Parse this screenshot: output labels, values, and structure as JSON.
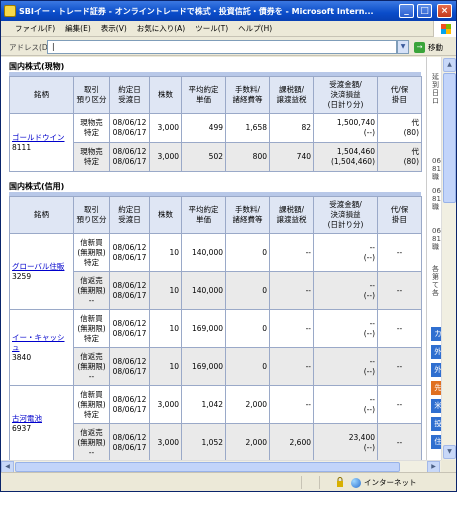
{
  "window": {
    "title": "SBIイー・トレード証券 - オンライントレードで株式・投資信託・債券を - Microsoft Intern...",
    "min_label": "_",
    "max_label": "□",
    "close_label": "×"
  },
  "menu": [
    "ファイル(F)",
    "編集(E)",
    "表示(V)",
    "お気に入り(A)",
    "ツール(T)",
    "ヘルプ(H)"
  ],
  "address": {
    "label": "アドレス(D)",
    "value": "|",
    "dropdown": "▼",
    "go_label": "移動",
    "go_icon": "→"
  },
  "colors": {
    "title_blue": "#0a4cc9",
    "link": "#0000cc",
    "header_bg": "#dfe6f4",
    "shade": "#eaeaea"
  },
  "spot": {
    "title": "国内株式(現物)",
    "headers": [
      "銘柄",
      "取引\n預り区分",
      "約定日\n受渡日",
      "株数",
      "平均約定\n単価",
      "手数料/\n諸経費等",
      "課税額/\n譲渡益税",
      "受渡金額/\n決済損益\n(日計り分)",
      "代/保\n掛目"
    ],
    "rows": [
      {
        "name": "ゴールドウイン",
        "code": "8111",
        "type1": "現物売",
        "type2": "特定",
        "date1": "08/06/12",
        "date2": "08/06/17",
        "qty": "3,000",
        "price": "499",
        "fee": "1,658",
        "tax": "82",
        "amt1": "1,500,740",
        "amt2": "(--)",
        "col1": "代",
        "col2": "(80)"
      },
      {
        "name": "",
        "code": "",
        "type1": "現物売",
        "type2": "特定",
        "date1": "08/06/12",
        "date2": "08/06/17",
        "qty": "3,000",
        "price": "502",
        "fee": "800",
        "tax": "740",
        "amt1": "1,504,460",
        "amt2": "(1,504,460)",
        "col1": "代",
        "col2": "(80)"
      }
    ]
  },
  "margin": {
    "title": "国内株式(信用)",
    "headers": [
      "銘柄",
      "取引\n預り区分",
      "約定日\n受渡日",
      "株数",
      "平均約定\n単価",
      "手数料/\n諸経費等",
      "課税額/\n譲渡益税",
      "受渡金額/\n決済損益\n(日計り分)",
      "代/保\n掛目"
    ],
    "rows": [
      {
        "name": "グローバル住販",
        "code": "3259",
        "type1": "信新買",
        "type2": "(無期限)",
        "type3": "特定",
        "date1": "08/06/12",
        "date2": "08/06/17",
        "qty": "10",
        "price": "140,000",
        "fee": "0",
        "tax": "--",
        "amt1": "--",
        "amt2": "(--)",
        "col1": "--"
      },
      {
        "name": "",
        "code": "",
        "type1": "信返売",
        "type2": "(無期限)",
        "type3": "--",
        "date1": "08/06/12",
        "date2": "08/06/17",
        "qty": "10",
        "price": "140,000",
        "fee": "0",
        "tax": "--",
        "amt1": "--",
        "amt2": "(--)",
        "col1": "--"
      },
      {
        "name": "イー・キャッシュ",
        "code": "3840",
        "type1": "信新買",
        "type2": "(無期限)",
        "type3": "特定",
        "date1": "08/06/12",
        "date2": "08/06/17",
        "qty": "10",
        "price": "169,000",
        "fee": "0",
        "tax": "--",
        "amt1": "--",
        "amt2": "(--)",
        "col1": "--"
      },
      {
        "name": "",
        "code": "",
        "type1": "信返売",
        "type2": "(無期限)",
        "type3": "--",
        "date1": "08/06/12",
        "date2": "08/06/17",
        "qty": "10",
        "price": "169,000",
        "fee": "0",
        "tax": "--",
        "amt1": "--",
        "amt2": "(--)",
        "col1": "--"
      },
      {
        "name": "古河電池",
        "code": "6937",
        "type1": "信新買",
        "type2": "(無期限)",
        "type3": "特定",
        "date1": "08/06/12",
        "date2": "08/06/17",
        "qty": "3,000",
        "price": "1,042",
        "fee": "2,000",
        "tax": "--",
        "amt1": "--",
        "amt2": "(--)",
        "col1": "--"
      },
      {
        "name": "",
        "code": "",
        "type1": "信返売",
        "type2": "(無期限)",
        "type3": "--",
        "date1": "08/06/12",
        "date2": "08/06/17",
        "qty": "3,000",
        "price": "1,052",
        "fee": "2,000",
        "tax": "2,600",
        "amt1": "23,400",
        "amt2": "(--)",
        "col1": "--"
      }
    ]
  },
  "sidebar": {
    "text_top": "延\n到\n日\nロ",
    "text_mid1": "06\n81\n職",
    "text_mid2": "06\n81\n職",
    "text_mid3": "06\n81\n職",
    "text_mid4": "各\n第\nて\n各",
    "buttons": [
      {
        "label": "カ",
        "color": "#2f6fd0"
      },
      {
        "label": "外",
        "color": "#2f6fd0"
      },
      {
        "label": "外",
        "color": "#2f6fd0"
      },
      {
        "label": "先",
        "color": "#e07020"
      },
      {
        "label": "米",
        "color": "#2f6fd0"
      },
      {
        "label": "投",
        "color": "#2f6fd0"
      },
      {
        "label": "住",
        "color": "#2f6fd0"
      }
    ]
  },
  "scroll": {
    "up": "▲",
    "down": "▼",
    "left": "◀",
    "right": "▶"
  },
  "status": {
    "zone": "インターネット"
  }
}
